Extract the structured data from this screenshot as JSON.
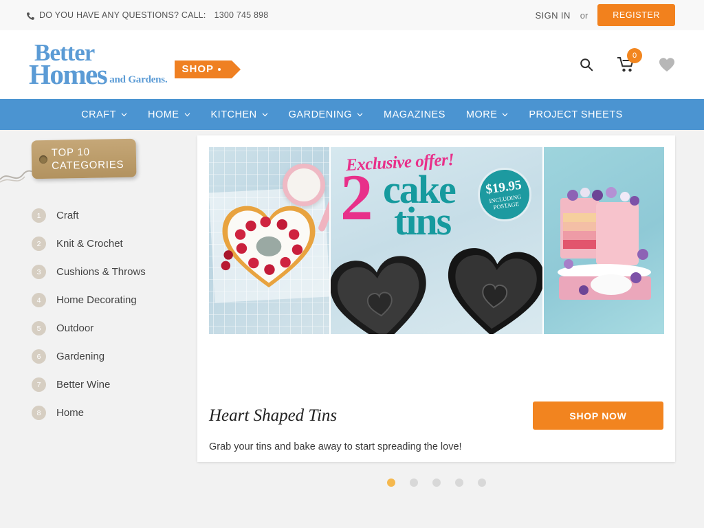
{
  "topbar": {
    "phone_icon": "phone-icon",
    "call_text": "DO YOU HAVE ANY QUESTIONS? CALL:",
    "phone_number": "1300 745 898",
    "sign_in": "SIGN IN",
    "or": "or",
    "register": "REGISTER"
  },
  "header": {
    "logo": {
      "line1": "Better",
      "line2": "Homes",
      "line3": "and Gardens.",
      "tag": "SHOP"
    },
    "icons": {
      "search": "search-icon",
      "cart": "cart-icon",
      "cart_count": "0",
      "wishlist": "heart-icon"
    }
  },
  "nav": {
    "items": [
      {
        "label": "CRAFT",
        "has_caret": true
      },
      {
        "label": "HOME",
        "has_caret": true
      },
      {
        "label": "KITCHEN",
        "has_caret": true
      },
      {
        "label": "GARDENING",
        "has_caret": true
      },
      {
        "label": "MAGAZINES",
        "has_caret": false
      },
      {
        "label": "MORE",
        "has_caret": true
      },
      {
        "label": "PROJECT SHEETS",
        "has_caret": false
      }
    ]
  },
  "sidebar": {
    "tag_line1": "TOP 10",
    "tag_line2": "CATEGORIES",
    "categories": [
      {
        "num": "1",
        "label": "Craft"
      },
      {
        "num": "2",
        "label": "Knit & Crochet"
      },
      {
        "num": "3",
        "label": "Cushions & Throws"
      },
      {
        "num": "4",
        "label": "Home Decorating"
      },
      {
        "num": "5",
        "label": "Outdoor"
      },
      {
        "num": "6",
        "label": "Gardening"
      },
      {
        "num": "7",
        "label": "Better Wine"
      },
      {
        "num": "8",
        "label": "Home"
      }
    ]
  },
  "hero": {
    "promo": {
      "exclusive": "Exclusive offer!",
      "big_number": "2",
      "word_cake": "cake",
      "word_tins": "tins",
      "price": "$19.95",
      "price_sub_line1": "INCLUDING",
      "price_sub_line2": "POSTAGE"
    },
    "title": "Heart Shaped Tins",
    "subtitle": "Grab your tins and bake away to start spreading the love!",
    "cta": "SHOP NOW",
    "slide_count": 5,
    "active_slide": 1
  },
  "colors": {
    "nav_blue": "#4b94d1",
    "orange": "#f2841f",
    "register_orange": "#f2811d",
    "logo_blue": "#5b9bd5",
    "promo_pink": "#e8308a",
    "promo_teal": "#169a9e",
    "dot_active": "#f5b84e",
    "page_bg": "#f2f2f2"
  }
}
